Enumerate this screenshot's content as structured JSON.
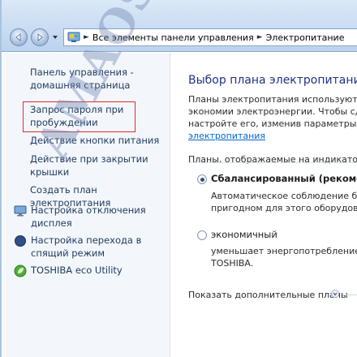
{
  "address_bar": {
    "crumbs": [
      "Все элементы панели управления",
      "Электропитание"
    ]
  },
  "sidebar": {
    "home": [
      "Панель управления -",
      "домашняя страница"
    ],
    "items": [
      {
        "lines": [
          "Запрос пароля при",
          "пробуждении"
        ]
      },
      {
        "lines": [
          "Действие кнопки питания"
        ]
      },
      {
        "lines": [
          "Действие при закрытии",
          "крышки"
        ]
      },
      {
        "lines": [
          "Создать план электропитания"
        ]
      },
      {
        "lines": [
          "Настройка отключения",
          "дисплея"
        ],
        "icon": "display-monitor-icon"
      },
      {
        "lines": [
          "Настройка перехода в",
          "спящий режим"
        ],
        "icon": "moon-sleep-icon"
      },
      {
        "lines": [
          "TOSHIBA eco Utility"
        ],
        "icon": "leaf-eco-icon"
      }
    ]
  },
  "main": {
    "title": "Выбор плана электропитания",
    "intro": [
      "Планы электропитания используютс",
      "экономии электроэнергии. Чтобы сде",
      "настройте его, изменив параметры эл"
    ],
    "intro_link": "электропитания",
    "group_label": "Планы, отображаемые на индикаторе",
    "plans": [
      {
        "name": "Сбалансированный (рекоменд",
        "desc": [
          "Автоматическое соблюдение ба",
          "пригодном для этого оборудова"
        ],
        "selected": true
      },
      {
        "name": "экономичный",
        "desc": [
          "уменьшает энергопотребление",
          "TOSHIBA."
        ],
        "selected": false
      }
    ],
    "show_more": "Показать дополнительные планы"
  },
  "watermark": "AMAOS.eu"
}
